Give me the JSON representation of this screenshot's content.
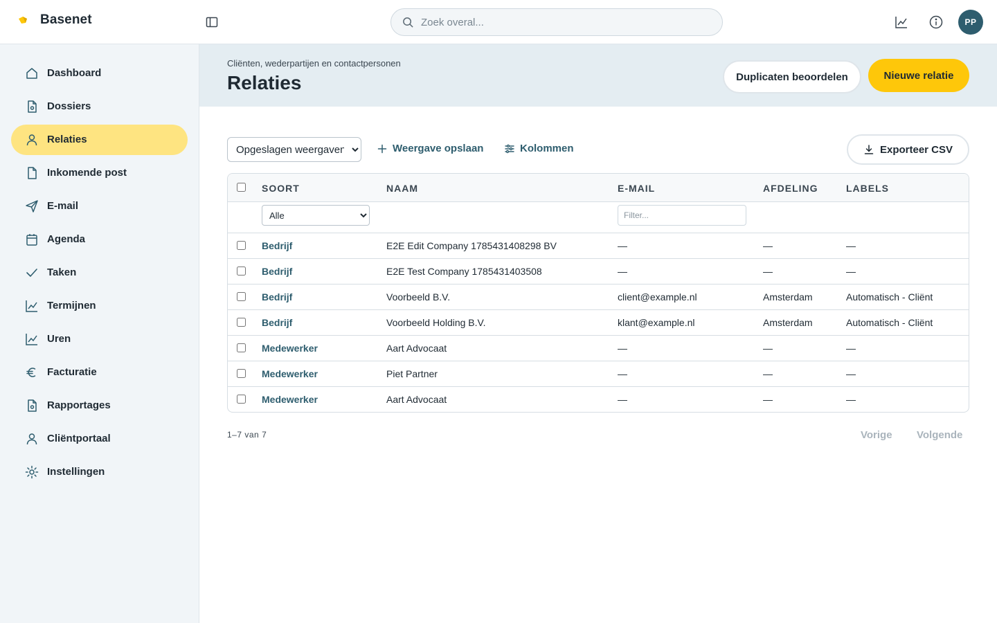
{
  "app": {
    "name": "Basenet"
  },
  "search": {
    "placeholder": "Zoek overal..."
  },
  "user": {
    "initials": "PP"
  },
  "sidebar": {
    "items": [
      {
        "label": "Dashboard",
        "icon": "home-icon",
        "active": false
      },
      {
        "label": "Dossiers",
        "icon": "file-icon",
        "active": false
      },
      {
        "label": "Relaties",
        "icon": "user-icon",
        "active": true
      },
      {
        "label": "Inkomende post",
        "icon": "document-icon",
        "active": false
      },
      {
        "label": "E-mail",
        "icon": "send-icon",
        "active": false
      },
      {
        "label": "Agenda",
        "icon": "calendar-icon",
        "active": false
      },
      {
        "label": "Taken",
        "icon": "check-icon",
        "active": false
      },
      {
        "label": "Termijnen",
        "icon": "chart-icon",
        "active": false
      },
      {
        "label": "Uren",
        "icon": "chart-icon",
        "active": false
      },
      {
        "label": "Facturatie",
        "icon": "euro-icon",
        "active": false
      },
      {
        "label": "Rapportages",
        "icon": "report-icon",
        "active": false
      },
      {
        "label": "Cliëntportaal",
        "icon": "user-icon",
        "active": false
      },
      {
        "label": "Instellingen",
        "icon": "settings-icon",
        "active": false
      }
    ]
  },
  "header": {
    "subtitle": "Cliënten, wederpartijen en contactpersonen",
    "title": "Relaties",
    "duplicates_label": "Duplicaten beoordelen",
    "new_label": "Nieuwe relatie"
  },
  "toolbar": {
    "saved_views_label": "Opgeslagen weergaven",
    "save_view_label": "Weergave opslaan",
    "columns_label": "Kolommen",
    "export_label": "Exporteer CSV"
  },
  "table": {
    "columns": [
      "SOORT",
      "NAAM",
      "E-MAIL",
      "AFDELING",
      "LABELS"
    ],
    "soort_filter_value": "Alle",
    "email_filter_placeholder": "Filter...",
    "rows": [
      {
        "type": "Bedrijf",
        "name": "E2E Edit Company 1785431408298 BV",
        "email": "—",
        "department": "—",
        "labels": "—"
      },
      {
        "type": "Bedrijf",
        "name": "E2E Test Company 1785431403508",
        "email": "—",
        "department": "—",
        "labels": "—"
      },
      {
        "type": "Bedrijf",
        "name": "Voorbeeld B.V.",
        "email": "client@example.nl",
        "department": "Amsterdam",
        "labels": "Automatisch - Cliënt"
      },
      {
        "type": "Bedrijf",
        "name": "Voorbeeld Holding B.V.",
        "email": "klant@example.nl",
        "department": "Amsterdam",
        "labels": "Automatisch - Cliënt"
      },
      {
        "type": "Medewerker",
        "name": "Aart Advocaat",
        "email": "—",
        "department": "—",
        "labels": "—"
      },
      {
        "type": "Medewerker",
        "name": "Piet Partner",
        "email": "—",
        "department": "—",
        "labels": "—"
      },
      {
        "type": "Medewerker",
        "name": "Aart Advocaat",
        "email": "—",
        "department": "—",
        "labels": "—"
      }
    ]
  },
  "pagination": {
    "range": "1–7",
    "of_label": "van",
    "total": "7",
    "prev_label": "Vorige",
    "next_label": "Volgende"
  },
  "colors": {
    "accent_yellow": "#fec70a",
    "active_nav": "#fee481",
    "link_teal": "#2e5d6e",
    "header_band": "#e4edf2",
    "sidebar_bg": "#f1f5f8"
  }
}
